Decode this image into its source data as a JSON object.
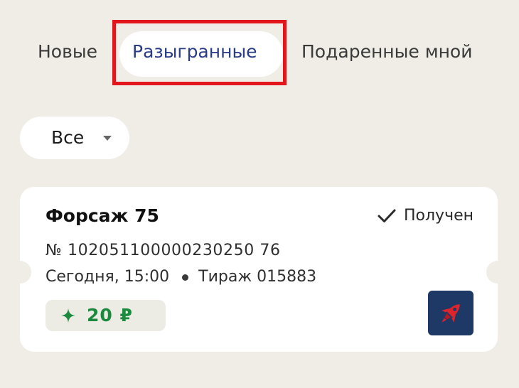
{
  "tabs": {
    "new": "Новые",
    "played": "Разыгранные",
    "gifted": "Подаренные мной",
    "active": "played"
  },
  "filter": {
    "value": "Все",
    "icon": "chevron-down-icon"
  },
  "ticket": {
    "title": "Форсаж 75",
    "status": "Получен",
    "status_icon": "check-icon",
    "number": "№ 102051100000230250 76",
    "date": "Сегодня, 15:00",
    "draw": "Тираж 015883",
    "prize": "20 ₽",
    "prize_icon": "sparkle-icon",
    "logo_icon": "rocket-icon"
  },
  "colors": {
    "background": "#efede6",
    "active_tab_text": "#2a3c85",
    "highlight_border": "#e3161d",
    "prize_text": "#1c8a3e",
    "logo_background": "#1f3966",
    "rocket": "#e0242b"
  }
}
